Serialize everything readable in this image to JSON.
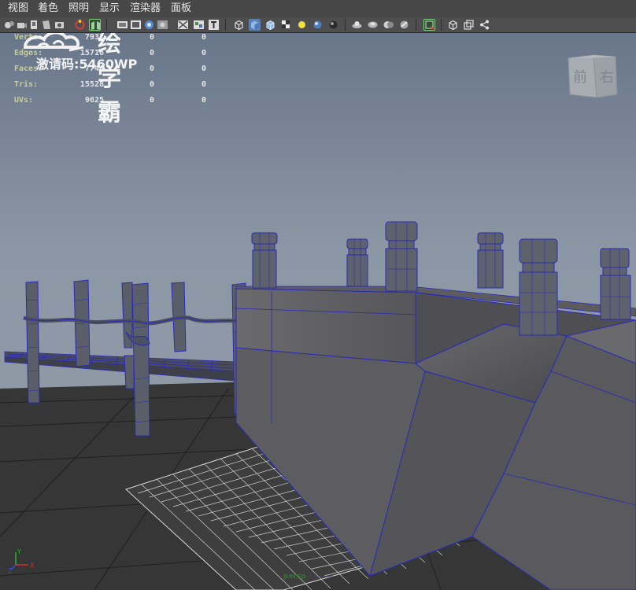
{
  "menubar": {
    "items": [
      "视图",
      "着色",
      "照明",
      "显示",
      "渲染器",
      "面板"
    ]
  },
  "toolbar": {
    "icons": [
      "select-camera-icon",
      "camera-attributes-icon",
      "bookmark-icon",
      "image-plane-icon",
      "snapshot-icon",
      "frame-all-icon",
      "grid-icon",
      "film-gate-icon",
      "resolution-gate-icon",
      "safe-action-icon",
      "field-chart-icon",
      "text-icon",
      "wireframe-icon",
      "smooth-shade-icon",
      "wireframe-on-shaded-icon",
      "textured-icon",
      "use-all-lights-icon",
      "shadows-icon",
      "ambient-occlusion-icon",
      "motion-blur-icon",
      "anti-alias-icon",
      "depth-of-field-icon",
      "isolate-select-icon",
      "xray-icon",
      "xray-joints-icon",
      "backface-culling-icon"
    ]
  },
  "hud": {
    "rows": [
      {
        "label": "Verts:",
        "v1": "7932",
        "v2": "0",
        "v3": "0"
      },
      {
        "label": "Edges:",
        "v1": "15716",
        "v2": "0",
        "v3": "0"
      },
      {
        "label": "Faces:",
        "v1": "7746",
        "v2": "0",
        "v3": "0"
      },
      {
        "label": "Tris:",
        "v1": "15528",
        "v2": "0",
        "v3": "0"
      },
      {
        "label": "UVs:",
        "v1": "9625",
        "v2": "0",
        "v3": "0"
      }
    ]
  },
  "watermark": {
    "brand": "绘学霸",
    "code": "激请码:5460WP"
  },
  "viewcube": {
    "front": "前",
    "right": "右"
  },
  "axis": {
    "x": "X",
    "y": "Y",
    "z": "Z"
  },
  "camera": {
    "label": "persp",
    "label2": "--------"
  },
  "colors": {
    "viewport_top": "#6b7786",
    "viewport_horizon": "#8a94a2",
    "ground": "#353535",
    "wire": "#2a2ab8",
    "mesh": "#5a5a5e"
  }
}
